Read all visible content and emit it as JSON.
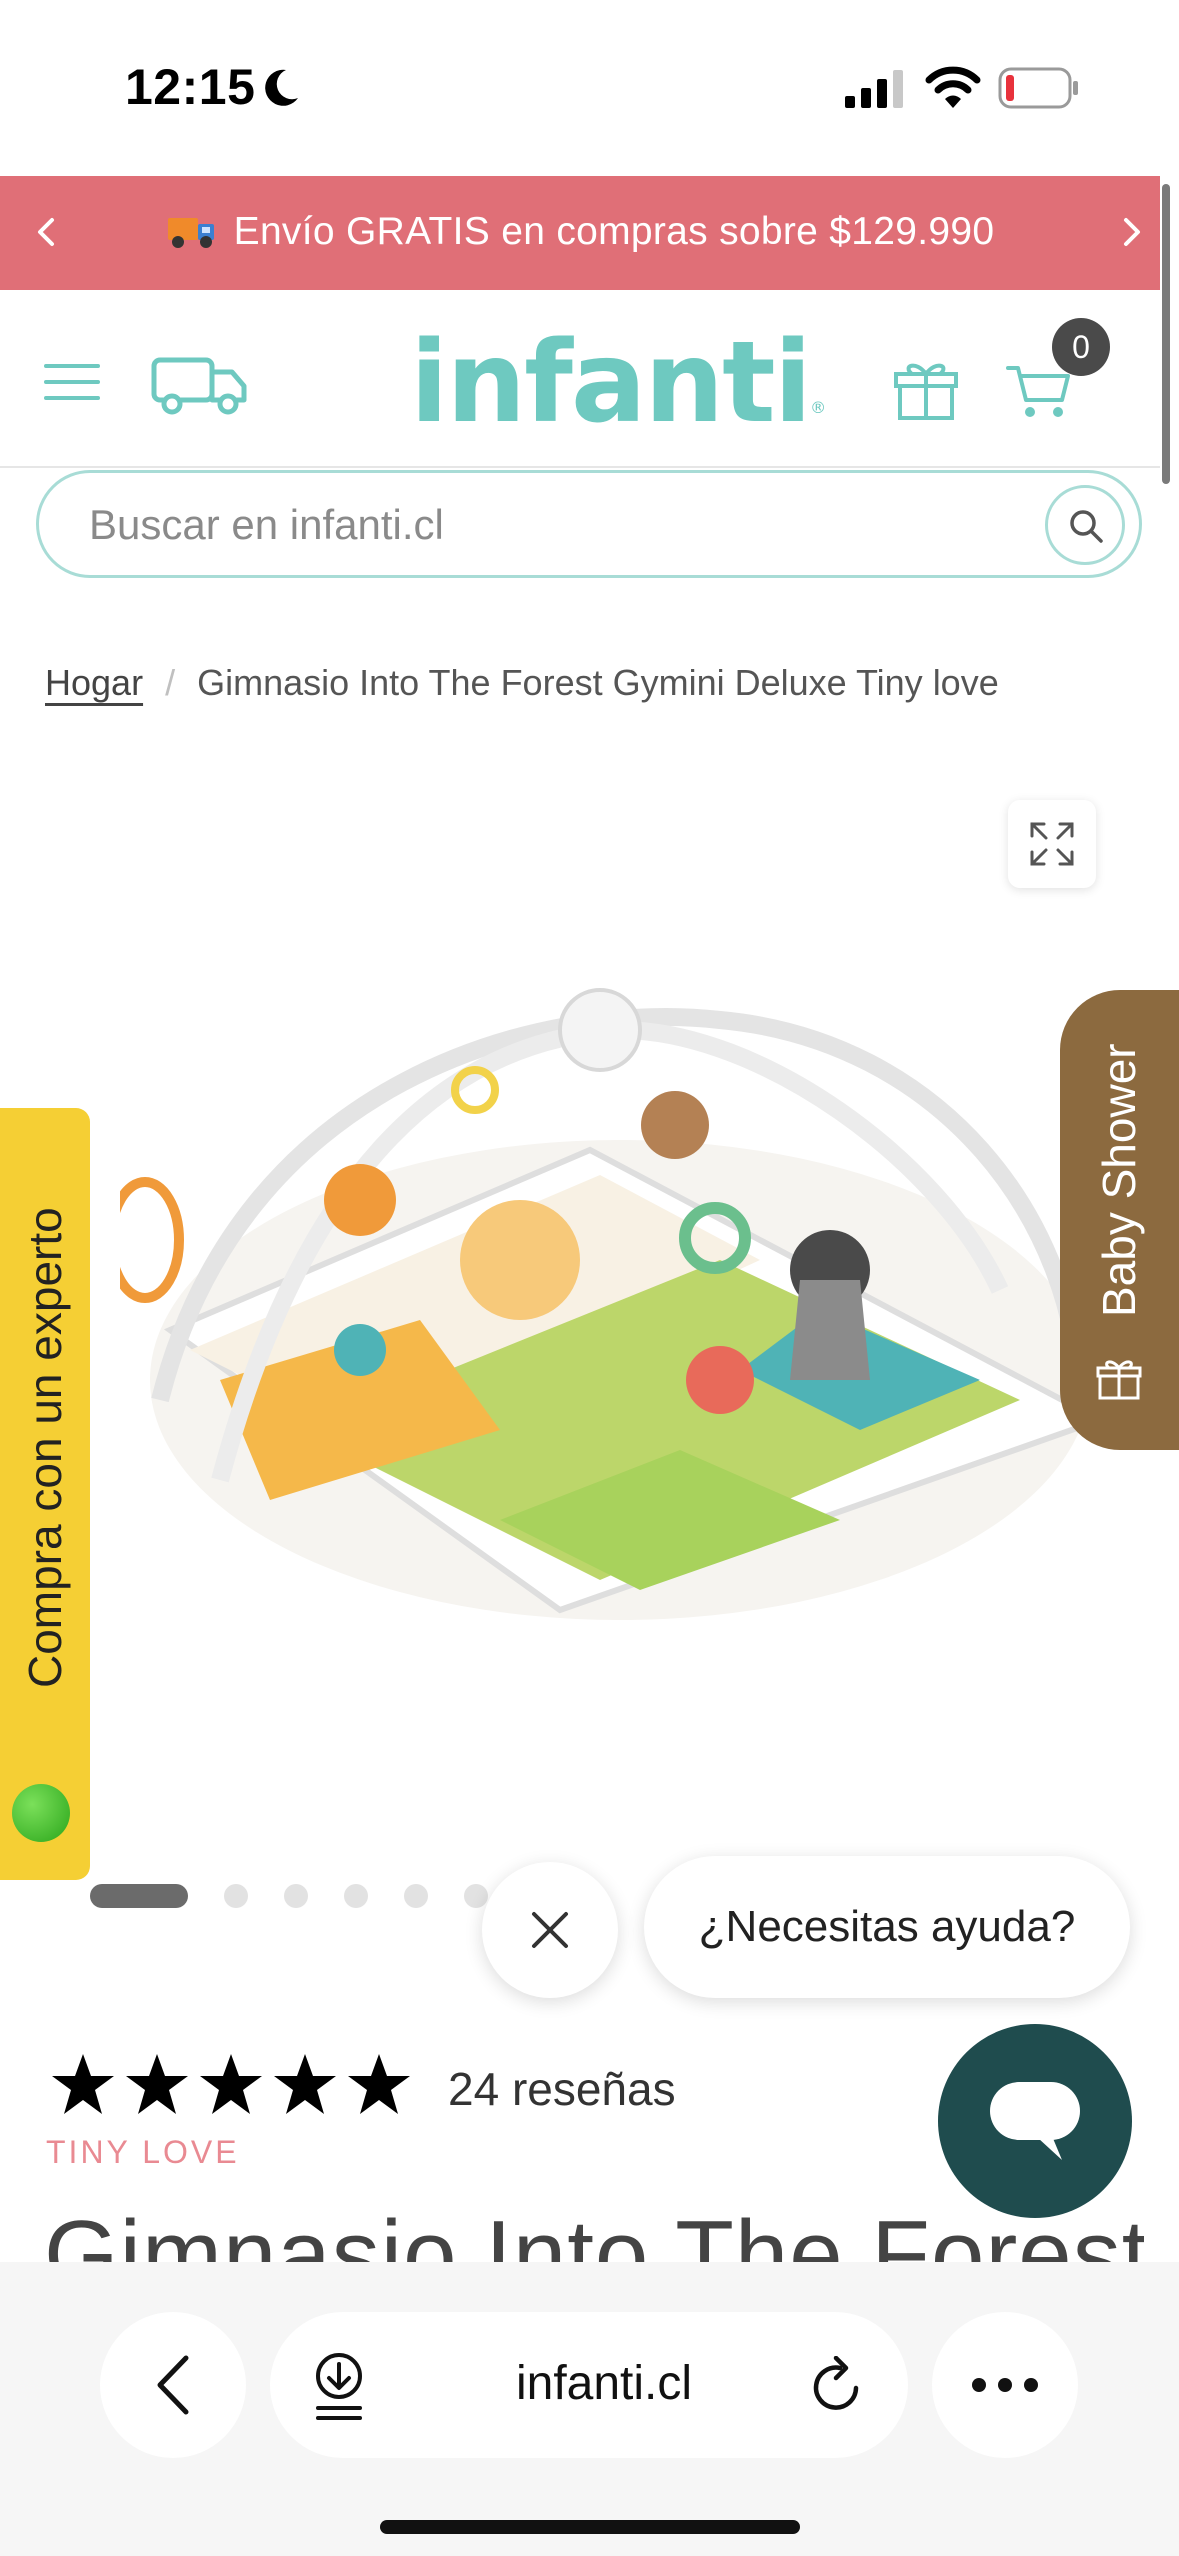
{
  "status_bar": {
    "time": "12:15",
    "icons": [
      "moon-icon",
      "signal-icon",
      "wifi-icon",
      "battery-icon"
    ]
  },
  "promo": {
    "text": "Envío GRATIS en compras sobre $129.990",
    "color": "#e06f77"
  },
  "header": {
    "logo": "infanti",
    "logo_mark": "®",
    "cart_count": "0",
    "accent": "#6ec9c0"
  },
  "search": {
    "placeholder": "Buscar en infanti.cl"
  },
  "breadcrumb": {
    "home": "Hogar",
    "separator": "/",
    "current": "Gimnasio Into The Forest Gymini Deluxe Tiny love"
  },
  "side_tabs": {
    "expert": "Compra con un experto",
    "baby_shower": "Baby Shower"
  },
  "carousel": {
    "active_index": 0
  },
  "help": {
    "bubble_text": "¿Necesitas ayuda?"
  },
  "product": {
    "rating": 5,
    "reviews": "24 reseñas",
    "brand": "TINY LOVE",
    "title": "Gimnasio Into The Forest Gymini Deluxe Tiny love"
  },
  "browser": {
    "url": "infanti.cl"
  }
}
